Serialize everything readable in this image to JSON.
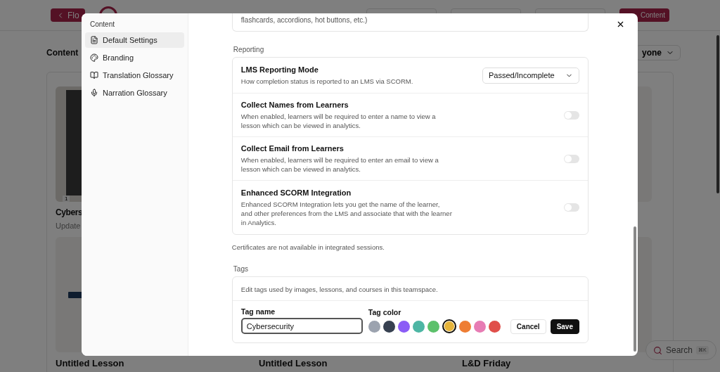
{
  "background": {
    "back_button": "Flo",
    "new_button": "Content",
    "heading": "Content",
    "filter": "yone",
    "cards": [
      {
        "title": "Cybers",
        "subtitle": "Update",
        "badge": "1",
        "kind": "picture"
      },
      {
        "kind": "blank"
      },
      {
        "kind": "blank"
      },
      {
        "title": "Untitled Lesson",
        "kind": "tag"
      },
      {
        "title": "Untitled Lesson",
        "kind": "blank"
      },
      {
        "title": "L&D Friday",
        "kind": "blank"
      }
    ],
    "search": {
      "label": "Search",
      "shortcut": "⌘K"
    }
  },
  "dialog": {
    "sidebar": {
      "heading": "Content",
      "items": [
        {
          "label": "Default Settings",
          "selected": true
        },
        {
          "label": "Branding",
          "selected": false
        },
        {
          "label": "Translation Glossary",
          "selected": false
        },
        {
          "label": "Narration Glossary",
          "selected": false
        }
      ]
    },
    "top_card_text": "flashcards, accordions, hot buttons, etc.)",
    "reporting": {
      "label": "Reporting",
      "rows": [
        {
          "kind": "select",
          "title": "LMS Reporting Mode",
          "description": "How completion status is reported to an LMS via SCORM.",
          "value": "Passed/Incomplete"
        },
        {
          "kind": "toggle",
          "title": "Collect Names from Learners",
          "description": "When enabled, learners will be required to enter a name to view a lesson which can be viewed in analytics.",
          "on": false
        },
        {
          "kind": "toggle",
          "title": "Collect Email from Learners",
          "description": "When enabled, learners will be required to enter an email to view a lesson which can be viewed in analytics.",
          "on": false
        },
        {
          "kind": "toggle",
          "title": "Enhanced SCORM Integration",
          "description": "Enhanced SCORM Integration lets you get the name of the learner, and other preferences from the LMS and associate that with the learner in Analytics.",
          "on": false
        }
      ]
    },
    "note": "Certificates are not available in integrated sessions.",
    "tags": {
      "label": "Tags",
      "description": "Edit tags used by images, lessons, and courses in this teamspace.",
      "name_label": "Tag name",
      "name_value": "Cybersecurity",
      "color_label": "Tag color",
      "colors": [
        {
          "color": "#9ca3af",
          "selected": false
        },
        {
          "color": "#374151",
          "selected": false
        },
        {
          "color": "#8b5cf6",
          "selected": false
        },
        {
          "color": "#4db6a4",
          "selected": false
        },
        {
          "color": "#5cc16b",
          "selected": false
        },
        {
          "color": "#e6b43a",
          "selected": true
        },
        {
          "color": "#ee7d33",
          "selected": false
        },
        {
          "color": "#e77cb4",
          "selected": false
        },
        {
          "color": "#e04f4a",
          "selected": false
        }
      ],
      "cancel": "Cancel",
      "save": "Save"
    }
  }
}
